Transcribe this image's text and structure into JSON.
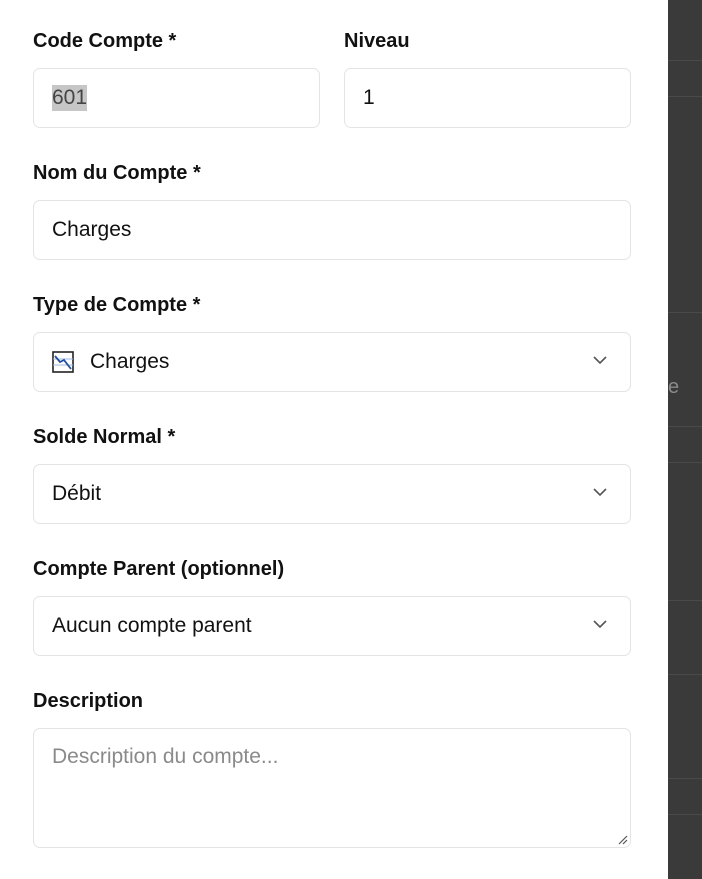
{
  "form": {
    "code_compte": {
      "label": "Code Compte *",
      "value": "601"
    },
    "niveau": {
      "label": "Niveau",
      "value": "1"
    },
    "nom_compte": {
      "label": "Nom du Compte *",
      "value": "Charges"
    },
    "type_compte": {
      "label": "Type de Compte *",
      "value": "Charges",
      "icon": "chart-decreasing-icon"
    },
    "solde_normal": {
      "label": "Solde Normal *",
      "value": "Débit"
    },
    "compte_parent": {
      "label": "Compte Parent (optionnel)",
      "value": "Aucun compte parent"
    },
    "description": {
      "label": "Description",
      "placeholder": "Description du compte..."
    }
  },
  "backdrop": {
    "partial_text": "e"
  },
  "colors": {
    "border": "#e4e4e7",
    "text": "#111111",
    "placeholder": "#8a8a8a",
    "selection": "#c6c6c6",
    "overlay": "#3a3a3a"
  }
}
